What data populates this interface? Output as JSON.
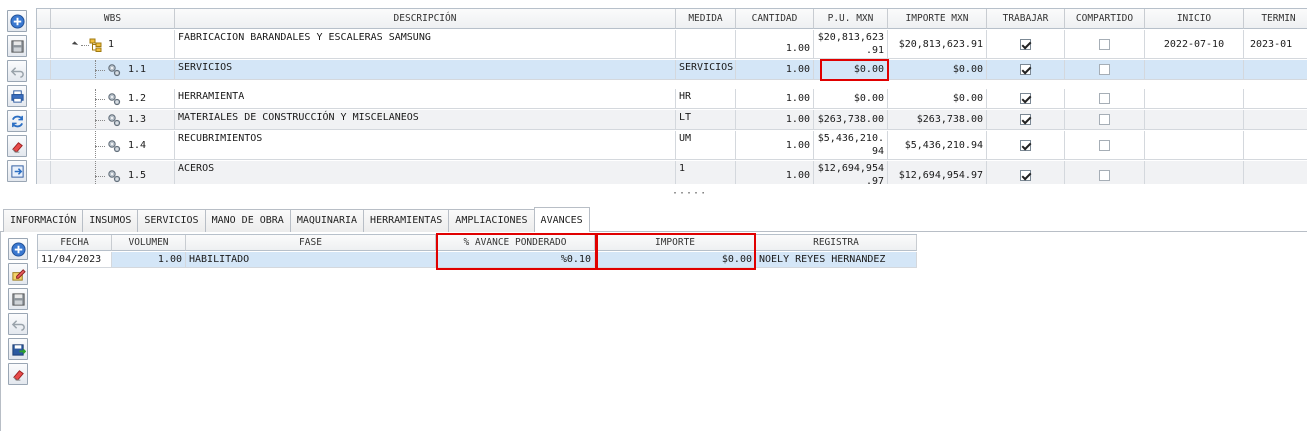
{
  "top_toolbar": [
    {
      "name": "add-button",
      "icon": "plus-circle-icon"
    },
    {
      "name": "save-button",
      "icon": "floppy-icon"
    },
    {
      "name": "undo-button",
      "icon": "undo-arrow-icon"
    },
    {
      "name": "print-button",
      "icon": "printer-icon"
    },
    {
      "name": "refresh-button",
      "icon": "refresh-icon"
    },
    {
      "name": "erase-button",
      "icon": "eraser-icon"
    },
    {
      "name": "export-button",
      "icon": "export-icon"
    }
  ],
  "wbs_grid": {
    "headers": {
      "wbs": "WBS",
      "descripcion": "DESCRIPCIÓN",
      "medida": "MEDIDA",
      "cantidad": "CANTIDAD",
      "pu": "P.U. MXN",
      "importe": "IMPORTE MXN",
      "trabajar": "TRABAJAR",
      "compartido": "COMPARTIDO",
      "inicio": "INICIO",
      "termino": "TERMIN"
    },
    "rows": [
      {
        "wbs": "1",
        "level": 0,
        "descripcion": "FABRICACION BARANDALES Y ESCALERAS SAMSUNG",
        "medida": "",
        "cantidad": "1.00",
        "pu_line1": "$20,813,623",
        "pu_line2": ".91",
        "importe": "$20,813,623.91",
        "trabajar": true,
        "compartido": false,
        "inicio": "2022-07-10",
        "termino": "2023-01"
      },
      {
        "wbs": "1.1",
        "level": 1,
        "descripcion": "SERVICIOS",
        "medida": "SERVICIOS",
        "cantidad": "1.00",
        "pu_line1": "$0.00",
        "pu_line2": "",
        "importe": "$0.00",
        "trabajar": true,
        "compartido": false,
        "inicio": "",
        "termino": ""
      },
      {
        "wbs": "1.2",
        "level": 1,
        "descripcion": "HERRAMIENTA",
        "medida": "HR",
        "cantidad": "1.00",
        "pu_line1": "$0.00",
        "pu_line2": "",
        "importe": "$0.00",
        "trabajar": true,
        "compartido": false,
        "inicio": "",
        "termino": ""
      },
      {
        "wbs": "1.3",
        "level": 1,
        "descripcion": "MATERIALES DE CONSTRUCCIÓN Y MISCELANEOS",
        "medida": "LT",
        "cantidad": "1.00",
        "pu_line1": "$263,738.00",
        "pu_line2": "",
        "importe": "$263,738.00",
        "trabajar": true,
        "compartido": false,
        "inicio": "",
        "termino": ""
      },
      {
        "wbs": "1.4",
        "level": 1,
        "descripcion": "RECUBRIMIENTOS",
        "medida": "UM",
        "cantidad": "1.00",
        "pu_line1": "$5,436,210.",
        "pu_line2": "94",
        "importe": "$5,436,210.94",
        "trabajar": true,
        "compartido": false,
        "inicio": "",
        "termino": ""
      },
      {
        "wbs": "1.5",
        "level": 1,
        "descripcion": "ACEROS",
        "medida": "1",
        "cantidad": "1.00",
        "pu_line1": "$12,694,954",
        "pu_line2": ".97",
        "importe": "$12,694,954.97",
        "trabajar": true,
        "compartido": false,
        "inicio": "",
        "termino": ""
      }
    ]
  },
  "splitter": "·····",
  "tabs": [
    {
      "label": "INFORMACIÓN",
      "active": false
    },
    {
      "label": "INSUMOS",
      "active": false
    },
    {
      "label": "SERVICIOS",
      "active": false
    },
    {
      "label": "MANO DE OBRA",
      "active": false
    },
    {
      "label": "MAQUINARIA",
      "active": false
    },
    {
      "label": "HERRAMIENTAS",
      "active": false
    },
    {
      "label": "AMPLIACIONES",
      "active": false
    },
    {
      "label": "AVANCES",
      "active": true
    }
  ],
  "bottom_toolbar": [
    {
      "name": "add-avance-button",
      "icon": "plus-circle-icon"
    },
    {
      "name": "edit-avance-button",
      "icon": "edit-icon"
    },
    {
      "name": "save-avance-button",
      "icon": "floppy-icon"
    },
    {
      "name": "undo-avance-button",
      "icon": "undo-arrow-icon"
    },
    {
      "name": "export-avance-button",
      "icon": "save-export-icon"
    },
    {
      "name": "erase-avance-button",
      "icon": "eraser-icon"
    }
  ],
  "avances_grid": {
    "headers": {
      "fecha": "FECHA",
      "volumen": "VOLUMEN",
      "fase": "FASE",
      "avance": "% AVANCE PONDERADO",
      "importe": "IMPORTE",
      "registra": "REGISTRA"
    },
    "rows": [
      {
        "fecha": "11/04/2023",
        "volumen": "1.00",
        "fase": "HABILITADO",
        "avance": "%0.10",
        "importe": "$0.00",
        "registra": "NOELY REYES HERNANDEZ"
      }
    ]
  },
  "colors": {
    "highlight": "#e00000",
    "selection": "#d4e6f7"
  }
}
